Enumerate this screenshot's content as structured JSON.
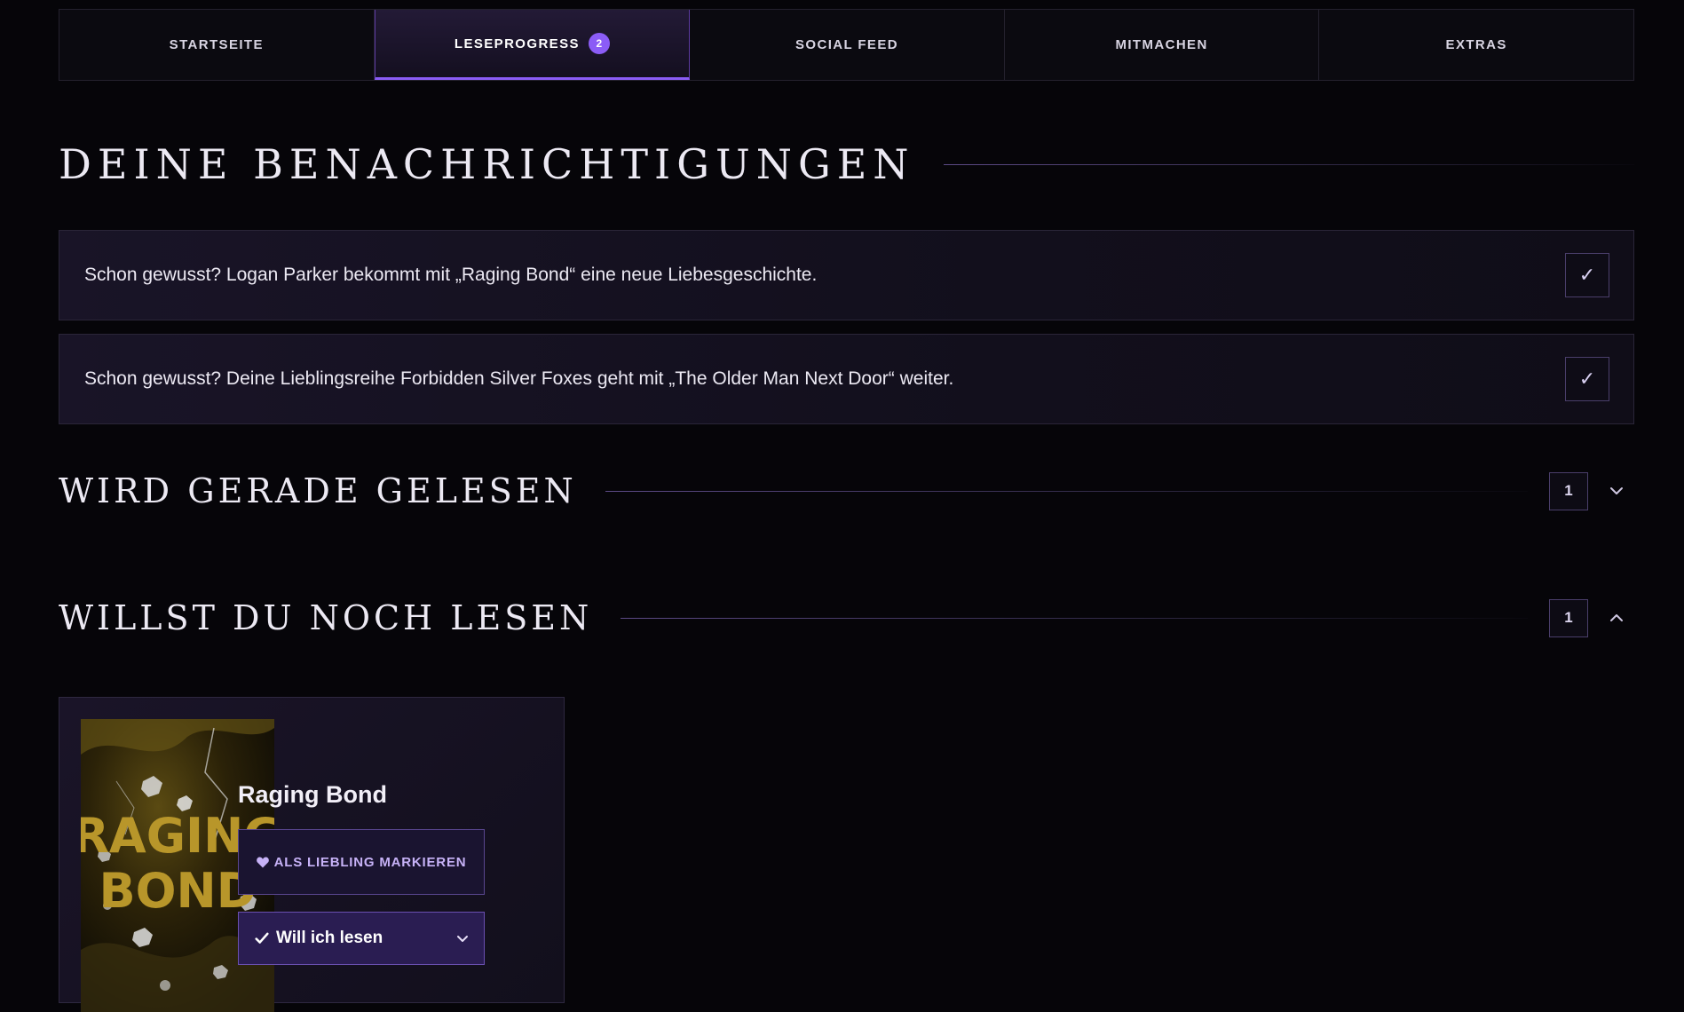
{
  "tabs": [
    {
      "label": "STARTSEITE",
      "active": false
    },
    {
      "label": "LESEPROGRESS",
      "active": true,
      "badge": "2"
    },
    {
      "label": "SOCIAL FEED",
      "active": false
    },
    {
      "label": "MITMACHEN",
      "active": false
    },
    {
      "label": "EXTRAS",
      "active": false
    }
  ],
  "notifications": {
    "title": "Deine Benachrichtigungen",
    "items": [
      {
        "text": "Schon gewusst? Logan Parker bekommt mit „Raging Bond“ eine neue Liebesgeschichte.",
        "action_icon": "check-icon",
        "action_glyph": "✓"
      },
      {
        "text": "Schon gewusst? Deine Lieblingsreihe Forbidden Silver Foxes geht mit „The Older Man Next Door“ weiter.",
        "action_icon": "check-icon",
        "action_glyph": "✓"
      }
    ]
  },
  "currently_reading": {
    "title": "Wird gerade gelesen",
    "count": "1",
    "expanded": false,
    "toggle_icon": "chevron-down-icon"
  },
  "want_to_read": {
    "title": "Willst du noch lesen",
    "count": "1",
    "expanded": true,
    "toggle_icon": "chevron-up-icon",
    "books": [
      {
        "title": "Raging Bond",
        "cover_text_line1": "RAGING",
        "cover_text_line2": "BOND",
        "favorite_label": "ALS LIEBLING MARKIEREN",
        "favorite_icon": "heart-icon",
        "status_label": "Will ich lesen",
        "status_icon": "check-icon",
        "status_dropdown_icon": "chevron-down-icon"
      }
    ]
  },
  "colors": {
    "background": "#060509",
    "accent": "#8b5cf6",
    "card": "#191427",
    "cover_text": "#b8962a"
  }
}
